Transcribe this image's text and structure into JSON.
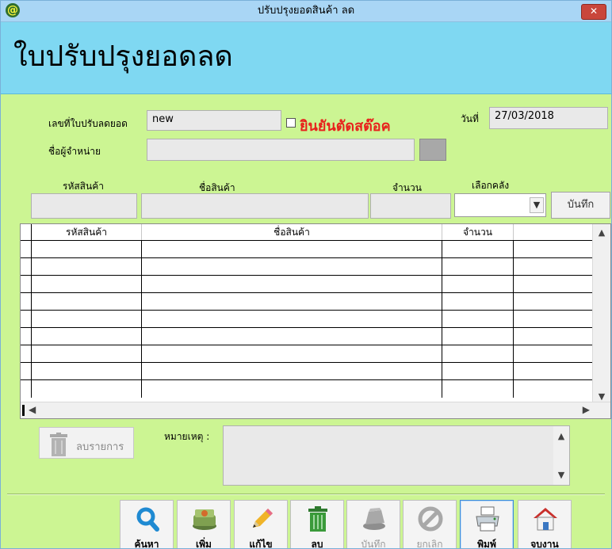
{
  "window": {
    "title": "ปรับปรุงยอดสินค้า ลด",
    "icon_char": "@",
    "close_char": "✕"
  },
  "header": {
    "title": "ใบปรับปรุงยอดลด"
  },
  "form": {
    "doc_no_label": "เลขที่ใบปรับลดยอด",
    "doc_no_value": "new",
    "confirm_label": "ยินยันตัดสต๊อค",
    "date_label": "วันที่",
    "date_value": "27/03/2018",
    "supplier_label": "ชื่อผู้จำหน่าย",
    "supplier_value": ""
  },
  "entry": {
    "code_label": "รหัสสินค้า",
    "name_label": "ชื่อสินค้า",
    "qty_label": "จำนวน",
    "warehouse_label": "เลือกคลัง",
    "save_label": "บันทึก"
  },
  "grid": {
    "columns": [
      "รหัสสินค้า",
      "ชื่อสินค้า",
      "จำนวน"
    ],
    "empty_rows": 9
  },
  "remark": {
    "delete_item_label": "ลบรายการ",
    "label": "หมายเหตุ :",
    "value": ""
  },
  "toolbar": {
    "search": "ค้นหา",
    "add": "เพิ่ม",
    "edit": "แก้ไข",
    "delete": "ลบ",
    "save": "บันทึก",
    "cancel": "ยกเลิก",
    "print": "พิมพ์",
    "exit": "จบงาน"
  }
}
